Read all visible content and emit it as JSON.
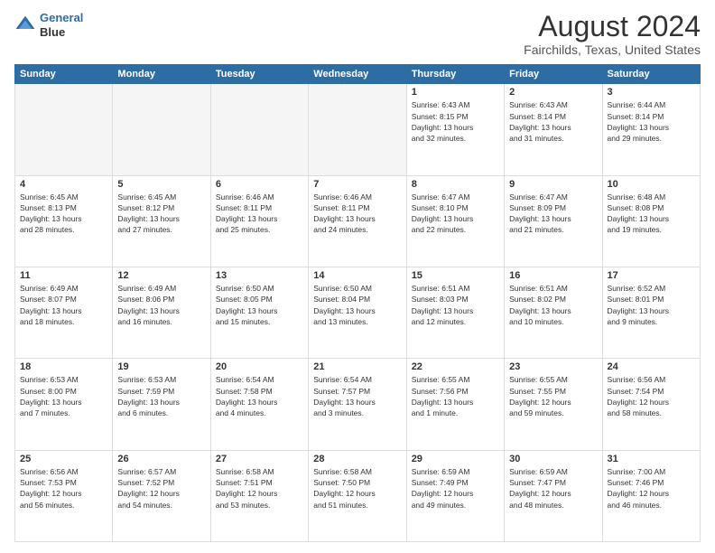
{
  "logo": {
    "line1": "General",
    "line2": "Blue"
  },
  "calendar": {
    "title": "August 2024",
    "subtitle": "Fairchilds, Texas, United States",
    "days_of_week": [
      "Sunday",
      "Monday",
      "Tuesday",
      "Wednesday",
      "Thursday",
      "Friday",
      "Saturday"
    ],
    "weeks": [
      [
        {
          "day": "",
          "info": ""
        },
        {
          "day": "",
          "info": ""
        },
        {
          "day": "",
          "info": ""
        },
        {
          "day": "",
          "info": ""
        },
        {
          "day": "1",
          "info": "Sunrise: 6:43 AM\nSunset: 8:15 PM\nDaylight: 13 hours\nand 32 minutes."
        },
        {
          "day": "2",
          "info": "Sunrise: 6:43 AM\nSunset: 8:14 PM\nDaylight: 13 hours\nand 31 minutes."
        },
        {
          "day": "3",
          "info": "Sunrise: 6:44 AM\nSunset: 8:14 PM\nDaylight: 13 hours\nand 29 minutes."
        }
      ],
      [
        {
          "day": "4",
          "info": "Sunrise: 6:45 AM\nSunset: 8:13 PM\nDaylight: 13 hours\nand 28 minutes."
        },
        {
          "day": "5",
          "info": "Sunrise: 6:45 AM\nSunset: 8:12 PM\nDaylight: 13 hours\nand 27 minutes."
        },
        {
          "day": "6",
          "info": "Sunrise: 6:46 AM\nSunset: 8:11 PM\nDaylight: 13 hours\nand 25 minutes."
        },
        {
          "day": "7",
          "info": "Sunrise: 6:46 AM\nSunset: 8:11 PM\nDaylight: 13 hours\nand 24 minutes."
        },
        {
          "day": "8",
          "info": "Sunrise: 6:47 AM\nSunset: 8:10 PM\nDaylight: 13 hours\nand 22 minutes."
        },
        {
          "day": "9",
          "info": "Sunrise: 6:47 AM\nSunset: 8:09 PM\nDaylight: 13 hours\nand 21 minutes."
        },
        {
          "day": "10",
          "info": "Sunrise: 6:48 AM\nSunset: 8:08 PM\nDaylight: 13 hours\nand 19 minutes."
        }
      ],
      [
        {
          "day": "11",
          "info": "Sunrise: 6:49 AM\nSunset: 8:07 PM\nDaylight: 13 hours\nand 18 minutes."
        },
        {
          "day": "12",
          "info": "Sunrise: 6:49 AM\nSunset: 8:06 PM\nDaylight: 13 hours\nand 16 minutes."
        },
        {
          "day": "13",
          "info": "Sunrise: 6:50 AM\nSunset: 8:05 PM\nDaylight: 13 hours\nand 15 minutes."
        },
        {
          "day": "14",
          "info": "Sunrise: 6:50 AM\nSunset: 8:04 PM\nDaylight: 13 hours\nand 13 minutes."
        },
        {
          "day": "15",
          "info": "Sunrise: 6:51 AM\nSunset: 8:03 PM\nDaylight: 13 hours\nand 12 minutes."
        },
        {
          "day": "16",
          "info": "Sunrise: 6:51 AM\nSunset: 8:02 PM\nDaylight: 13 hours\nand 10 minutes."
        },
        {
          "day": "17",
          "info": "Sunrise: 6:52 AM\nSunset: 8:01 PM\nDaylight: 13 hours\nand 9 minutes."
        }
      ],
      [
        {
          "day": "18",
          "info": "Sunrise: 6:53 AM\nSunset: 8:00 PM\nDaylight: 13 hours\nand 7 minutes."
        },
        {
          "day": "19",
          "info": "Sunrise: 6:53 AM\nSunset: 7:59 PM\nDaylight: 13 hours\nand 6 minutes."
        },
        {
          "day": "20",
          "info": "Sunrise: 6:54 AM\nSunset: 7:58 PM\nDaylight: 13 hours\nand 4 minutes."
        },
        {
          "day": "21",
          "info": "Sunrise: 6:54 AM\nSunset: 7:57 PM\nDaylight: 13 hours\nand 3 minutes."
        },
        {
          "day": "22",
          "info": "Sunrise: 6:55 AM\nSunset: 7:56 PM\nDaylight: 13 hours\nand 1 minute."
        },
        {
          "day": "23",
          "info": "Sunrise: 6:55 AM\nSunset: 7:55 PM\nDaylight: 12 hours\nand 59 minutes."
        },
        {
          "day": "24",
          "info": "Sunrise: 6:56 AM\nSunset: 7:54 PM\nDaylight: 12 hours\nand 58 minutes."
        }
      ],
      [
        {
          "day": "25",
          "info": "Sunrise: 6:56 AM\nSunset: 7:53 PM\nDaylight: 12 hours\nand 56 minutes."
        },
        {
          "day": "26",
          "info": "Sunrise: 6:57 AM\nSunset: 7:52 PM\nDaylight: 12 hours\nand 54 minutes."
        },
        {
          "day": "27",
          "info": "Sunrise: 6:58 AM\nSunset: 7:51 PM\nDaylight: 12 hours\nand 53 minutes."
        },
        {
          "day": "28",
          "info": "Sunrise: 6:58 AM\nSunset: 7:50 PM\nDaylight: 12 hours\nand 51 minutes."
        },
        {
          "day": "29",
          "info": "Sunrise: 6:59 AM\nSunset: 7:49 PM\nDaylight: 12 hours\nand 49 minutes."
        },
        {
          "day": "30",
          "info": "Sunrise: 6:59 AM\nSunset: 7:47 PM\nDaylight: 12 hours\nand 48 minutes."
        },
        {
          "day": "31",
          "info": "Sunrise: 7:00 AM\nSunset: 7:46 PM\nDaylight: 12 hours\nand 46 minutes."
        }
      ]
    ]
  }
}
